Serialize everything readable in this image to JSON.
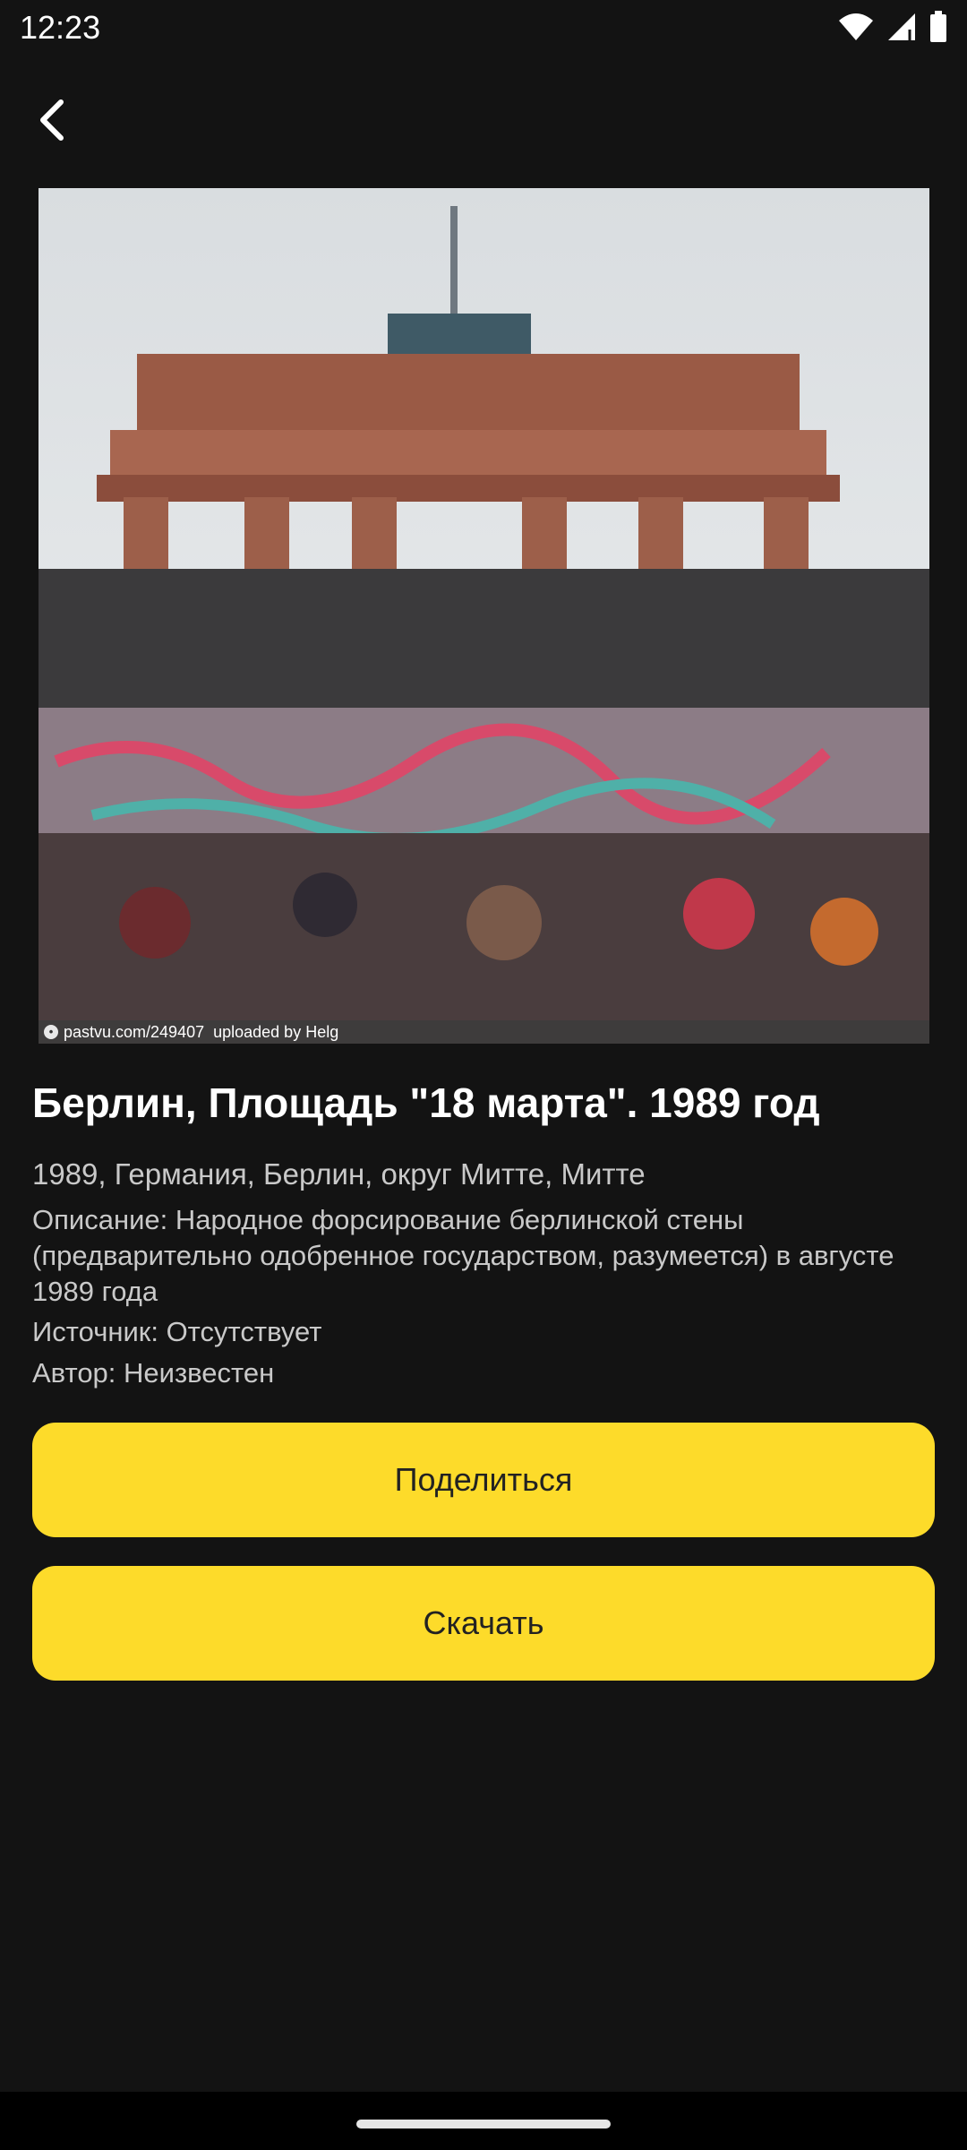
{
  "status_bar": {
    "time": "12:23",
    "icons": [
      "wifi-icon",
      "signal-icon",
      "battery-icon"
    ]
  },
  "toolbar": {
    "back_icon": "chevron-left-icon"
  },
  "photo": {
    "caption_url": "pastvu.com/249407",
    "caption_uploader": "uploaded by Helg"
  },
  "details": {
    "title": "Берлин, Площадь \"18 марта\". 1989 год",
    "location": "1989, Германия, Берлин, округ Митте, Митте",
    "description": "Описание: Народное форсирование берлинской стены (предварительно одобренное государством, разумеется) в августе 1989 года",
    "source": "Источник: Отсутствует",
    "author": "Автор: Неизвестен"
  },
  "actions": {
    "share_label": "Поделиться",
    "download_label": "Скачать"
  },
  "colors": {
    "background": "#131313",
    "accent_button": "#fddb2a",
    "button_text": "#222222",
    "secondary_text": "#c9c9c9"
  }
}
